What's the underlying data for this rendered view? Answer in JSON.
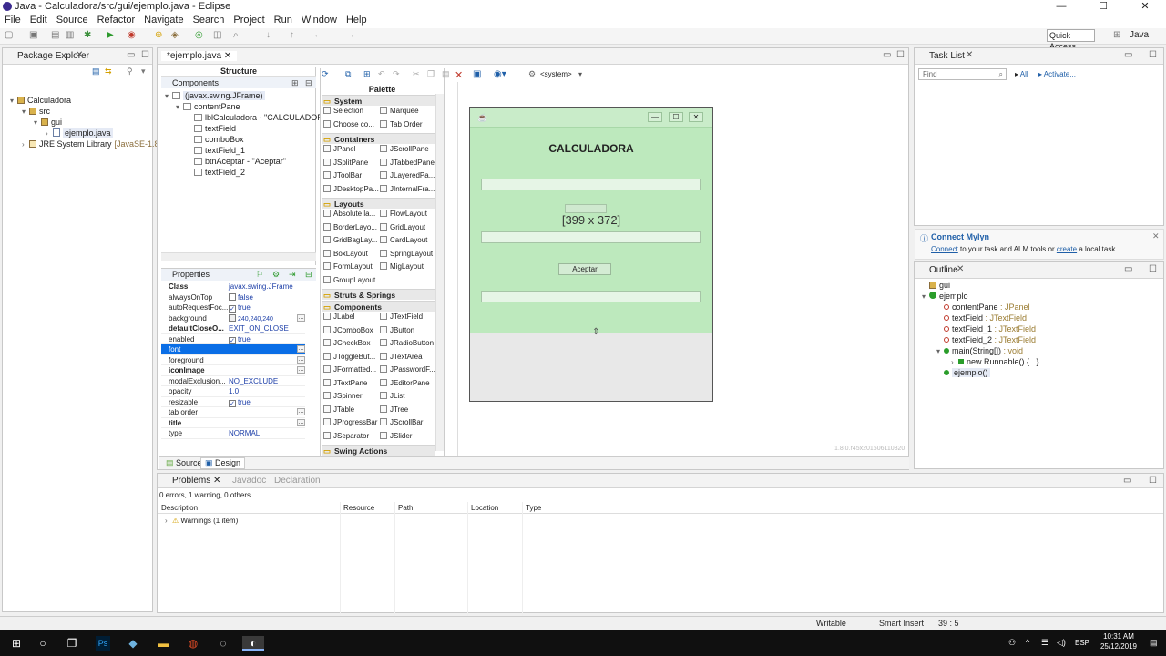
{
  "window": {
    "title": "Java - Calculadora/src/gui/ejemplo.java - Eclipse",
    "controls": {
      "minimize": "—",
      "maximize": "☐",
      "close": "✕"
    }
  },
  "menu": [
    "File",
    "Edit",
    "Source",
    "Refactor",
    "Navigate",
    "Search",
    "Project",
    "Run",
    "Window",
    "Help"
  ],
  "toolbar": {
    "quick_access": "Quick Access",
    "perspective": "Java"
  },
  "package_explorer": {
    "tab": "Package Explorer",
    "items": [
      {
        "label": "Calculadora",
        "indent": 0
      },
      {
        "label": "src",
        "indent": 1
      },
      {
        "label": "gui",
        "indent": 2
      },
      {
        "label": "ejemplo.java",
        "indent": 3
      },
      {
        "label": "JRE System Library",
        "suffix": "[JavaSE-1.8]",
        "indent": 1
      }
    ]
  },
  "editor": {
    "tab": "*ejemplo.java",
    "structure_label": "Structure",
    "components_label": "Components",
    "components": [
      {
        "label": "(javax.swing.JFrame)",
        "indent": 0
      },
      {
        "label": "contentPane",
        "indent": 1
      },
      {
        "label": "lblCalculadora - \"CALCULADORA\"",
        "indent": 2
      },
      {
        "label": "textField",
        "indent": 2
      },
      {
        "label": "comboBox",
        "indent": 2
      },
      {
        "label": "textField_1",
        "indent": 2
      },
      {
        "label": "btnAceptar - \"Aceptar\"",
        "indent": 2
      },
      {
        "label": "textField_2",
        "indent": 2
      }
    ],
    "properties_label": "Properties",
    "properties": [
      {
        "key": "Class",
        "value": "javax.swing.JFrame",
        "bold": true
      },
      {
        "key": "alwaysOnTop",
        "value": "false",
        "check": "off"
      },
      {
        "key": "autoRequestFoc...",
        "value": "true",
        "check": "on"
      },
      {
        "key": "background",
        "value": "240,240,240",
        "swatch": true
      },
      {
        "key": "defaultCloseO...",
        "value": "EXIT_ON_CLOSE",
        "bold": true
      },
      {
        "key": "enabled",
        "value": "true",
        "check": "on"
      },
      {
        "key": "font",
        "value": "",
        "selected": true
      },
      {
        "key": "foreground",
        "value": ""
      },
      {
        "key": "iconImage",
        "value": "",
        "bold": true
      },
      {
        "key": "modalExclusion...",
        "value": "NO_EXCLUDE"
      },
      {
        "key": "opacity",
        "value": "1.0"
      },
      {
        "key": "resizable",
        "value": "true",
        "check": "on"
      },
      {
        "key": "tab order",
        "value": ""
      },
      {
        "key": "title",
        "value": "",
        "bold": true
      },
      {
        "key": "type",
        "value": "NORMAL"
      }
    ],
    "palette_label": "Palette",
    "system_option": "<system>",
    "palette": {
      "system": {
        "title": "System",
        "items": [
          "Selection",
          "Marquee",
          "Choose co...",
          "Tab Order"
        ]
      },
      "containers": {
        "title": "Containers",
        "items": [
          "JPanel",
          "JScrollPane",
          "JSplitPane",
          "JTabbedPane",
          "JToolBar",
          "JLayeredPa...",
          "JDesktopPa...",
          "JInternalFra..."
        ]
      },
      "layouts": {
        "title": "Layouts",
        "items": [
          "Absolute la...",
          "FlowLayout",
          "BorderLayo...",
          "GridLayout",
          "GridBagLay...",
          "CardLayout",
          "BoxLayout",
          "SpringLayout",
          "FormLayout",
          "MigLayout",
          "GroupLayout"
        ]
      },
      "struts": {
        "title": "Struts & Springs"
      },
      "components": {
        "title": "Components",
        "items": [
          "JLabel",
          "JTextField",
          "JComboBox",
          "JButton",
          "JCheckBox",
          "JRadioButton",
          "JToggleBut...",
          "JTextArea",
          "JFormatted...",
          "JPasswordF...",
          "JTextPane",
          "JEditorPane",
          "JSpinner",
          "JList",
          "JTable",
          "JTree",
          "JProgressBar",
          "JScrollBar",
          "JSeparator",
          "JSlider"
        ]
      },
      "swing_actions": {
        "title": "Swing Actions"
      }
    },
    "design": {
      "heading": "CALCULADORA",
      "size_readout": "[399 x 372]",
      "button": "Aceptar",
      "version": "1.8.0.r45x201506110820"
    },
    "bottom_tabs": [
      "Source",
      "Design"
    ]
  },
  "task_list": {
    "tab": "Task List",
    "find_placeholder": "Find",
    "all": "All",
    "activate": "Activate..."
  },
  "mylyn": {
    "title": "Connect Mylyn",
    "link1": "Connect",
    "text1": " to your task and ALM tools or ",
    "link2": "create",
    "text2": " a local task."
  },
  "outline": {
    "tab": "Outline",
    "items": [
      {
        "label": "gui",
        "indent": 0,
        "kind": "pkg"
      },
      {
        "label": "ejemplo",
        "indent": 0,
        "kind": "class"
      },
      {
        "label": "contentPane",
        "type": " : JPanel",
        "indent": 1,
        "kind": "field"
      },
      {
        "label": "textField",
        "type": " : JTextField",
        "indent": 1,
        "kind": "field"
      },
      {
        "label": "textField_1",
        "type": " : JTextField",
        "indent": 1,
        "kind": "field"
      },
      {
        "label": "textField_2",
        "type": " : JTextField",
        "indent": 1,
        "kind": "field"
      },
      {
        "label": "main(String[])",
        "type": " : void",
        "indent": 1,
        "kind": "method"
      },
      {
        "label": "new Runnable() {...}",
        "indent": 2,
        "kind": "anon"
      },
      {
        "label": "ejemplo()",
        "indent": 1,
        "kind": "ctor"
      }
    ]
  },
  "problems": {
    "tabs": [
      "Problems",
      "Javadoc",
      "Declaration"
    ],
    "summary": "0 errors, 1 warning, 0 others",
    "columns": [
      "Description",
      "Resource",
      "Path",
      "Location",
      "Type"
    ],
    "rows": [
      {
        "label": "Warnings (1 item)"
      }
    ]
  },
  "status": {
    "writable": "Writable",
    "insert": "Smart Insert",
    "position": "39 : 5"
  },
  "taskbar": {
    "lang": "ESP",
    "time": "10:31 AM",
    "date": "25/12/2019"
  }
}
